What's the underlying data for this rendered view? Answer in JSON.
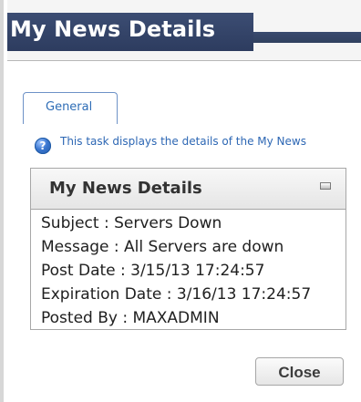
{
  "window": {
    "title": "My News Details"
  },
  "tabs": [
    {
      "label": "General"
    }
  ],
  "info": {
    "icon": "help-icon",
    "text": "This task displays the details of the My News"
  },
  "panel": {
    "title": "My News Details",
    "collapse_icon": "collapse-icon",
    "details": {
      "subject": "Subject : Servers Down",
      "message": "Message : All Servers are down",
      "post_date": "Post Date : 3/15/13 17:24:57",
      "expiration_date": "Expiration Date : 3/16/13 17:24:57",
      "posted_by": "Posted By : MAXADMIN"
    }
  },
  "footer": {
    "close_label": "Close"
  },
  "colors": {
    "title_bar": "#34466b",
    "link_text": "#2e6db6",
    "panel_border": "#a7a7a7"
  }
}
